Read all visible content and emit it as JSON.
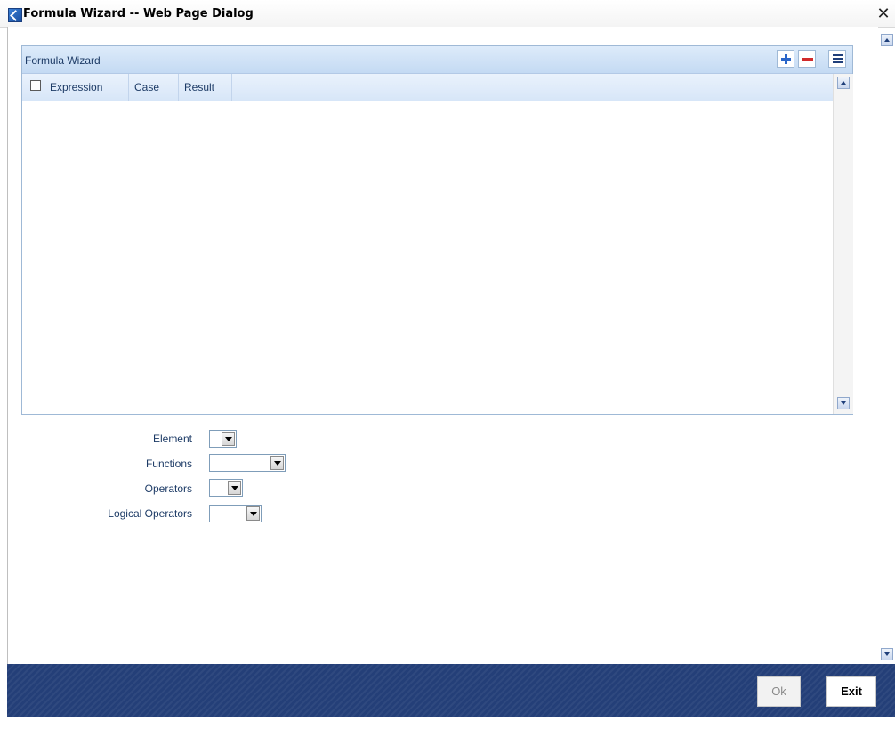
{
  "window": {
    "title": "Formula Wizard -- Web Page Dialog",
    "close_glyph": "✕"
  },
  "grid": {
    "title": "Formula Wizard",
    "columns": [
      "Expression",
      "Case",
      "Result"
    ],
    "rows": []
  },
  "form": {
    "element_label": "Element",
    "functions_label": "Functions",
    "operators_label": "Operators",
    "logical_operators_label": "Logical Operators",
    "element_value": "",
    "functions_value": "",
    "operators_value": "",
    "logical_operators_value": ""
  },
  "footer": {
    "ok_label": "Ok",
    "exit_label": "Exit"
  },
  "colors": {
    "footer_bg": "#243f78",
    "header_bg": "#c4daf3",
    "label_text": "#1d3b66"
  }
}
